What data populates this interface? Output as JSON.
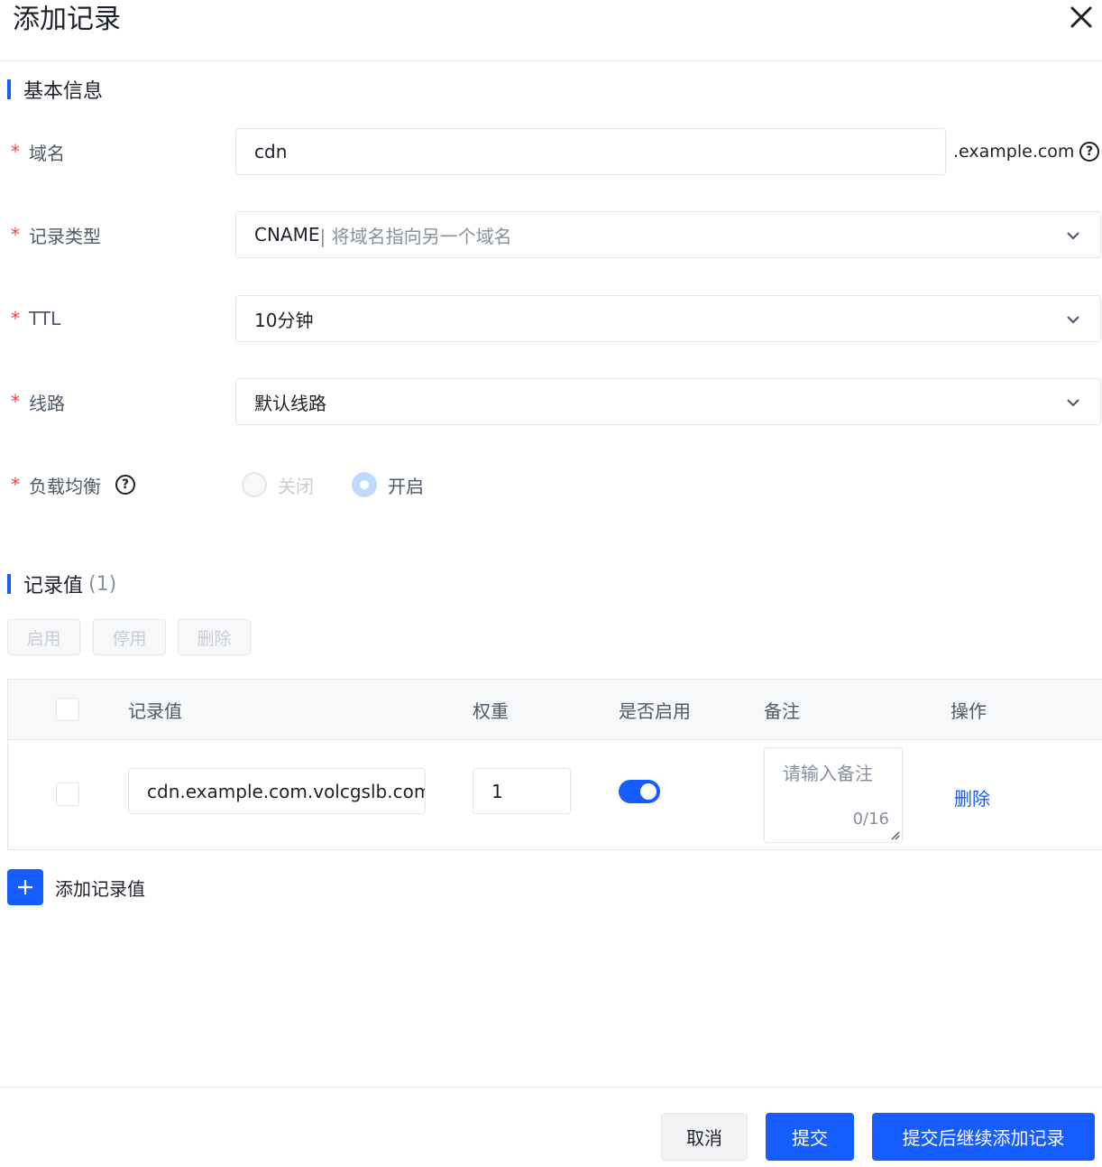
{
  "dialog": {
    "title": "添加记录"
  },
  "basic": {
    "section_title": "基本信息",
    "domain": {
      "label": "域名",
      "value": "cdn",
      "suffix": ".example.com"
    },
    "record_type": {
      "label": "记录类型",
      "value": "CNAME",
      "hint": "| 将域名指向另一个域名"
    },
    "ttl": {
      "label": "TTL",
      "value": "10分钟"
    },
    "line": {
      "label": "线路",
      "value": "默认线路"
    },
    "load_balance": {
      "label": "负载均衡",
      "options": [
        {
          "label": "关闭",
          "selected": false
        },
        {
          "label": "开启",
          "selected": true
        }
      ]
    }
  },
  "records": {
    "section_title": "记录值",
    "count": "(1)",
    "toolbar": {
      "enable_label": "启用",
      "disable_label": "停用",
      "delete_label": "删除"
    },
    "columns": [
      "记录值",
      "权重",
      "是否启用",
      "备注",
      "操作"
    ],
    "rows": [
      {
        "value": "cdn.example.com.volcgslb.com",
        "weight": "1",
        "enabled": true,
        "note_placeholder": "请输入备注",
        "note_count": "0/16",
        "action_label": "删除"
      }
    ],
    "add_label": "添加记录值"
  },
  "footer": {
    "cancel_label": "取消",
    "submit_label": "提交",
    "submit_continue_label": "提交后继续添加记录"
  },
  "colors": {
    "primary": "#165dff",
    "required": "#f53f3f",
    "border": "#e5e6eb"
  }
}
